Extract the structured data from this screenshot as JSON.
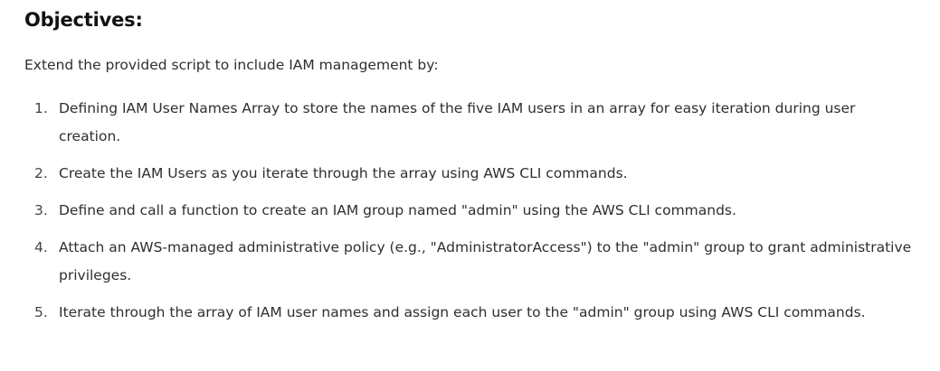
{
  "heading": "Objectives:",
  "intro": "Extend the provided script to include IAM management by:",
  "objectives": [
    {
      "number": "1.",
      "text": "Defining IAM User Names Array to store the names of the five IAM users in an array for easy iteration during user creation."
    },
    {
      "number": "2.",
      "text": "Create the IAM Users as you iterate through the array using AWS CLI commands."
    },
    {
      "number": "3.",
      "text": "Define and call a function to create an IAM group named \"admin\" using the AWS CLI commands."
    },
    {
      "number": "4.",
      "text": "Attach an AWS-managed administrative policy (e.g., \"AdministratorAccess\") to the \"admin\" group to grant administrative privileges."
    },
    {
      "number": "5.",
      "text": "Iterate through the array of IAM user names and assign each user to the \"admin\" group using AWS CLI commands."
    }
  ]
}
